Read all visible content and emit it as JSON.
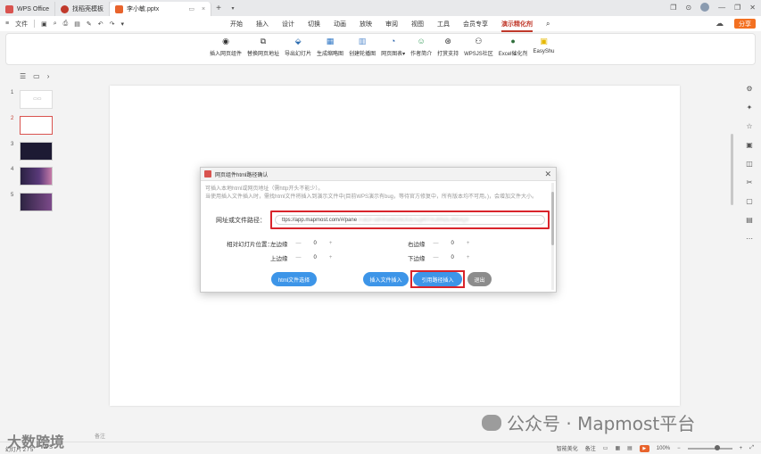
{
  "tabs": [
    {
      "label": "WPS Office",
      "color": "#d9534f"
    },
    {
      "label": "找稻壳模板",
      "color": "#c0392b"
    },
    {
      "label": "李小敏.pptx",
      "color": "#e8632c",
      "active": true
    }
  ],
  "menu": {
    "file": "文件",
    "tabs": [
      "开始",
      "插入",
      "设计",
      "切换",
      "动画",
      "放映",
      "审阅",
      "视图",
      "工具",
      "会员专享",
      "演示精化剂"
    ],
    "active_tab": "演示精化剂",
    "share": "分享"
  },
  "ribbon": [
    {
      "label": "插入网页组件",
      "icon": "chrome-icon",
      "glyph": "◉"
    },
    {
      "label": "替换网页地址",
      "icon": "swap-icon",
      "glyph": "⧉"
    },
    {
      "label": "导出幻灯片",
      "icon": "export-icon",
      "glyph": "⬙"
    },
    {
      "label": "生成缩略图",
      "icon": "grid-icon",
      "glyph": "▦"
    },
    {
      "label": "创建轮播图",
      "icon": "carousel-icon",
      "glyph": "▥"
    },
    {
      "label": "网页图表▾",
      "icon": "chart-icon",
      "glyph": "◔"
    },
    {
      "label": "作者简介",
      "icon": "author-icon",
      "glyph": "☺"
    },
    {
      "label": "打赏支持",
      "icon": "reward-icon",
      "glyph": "⊛"
    },
    {
      "label": "WPSJS社区",
      "icon": "community-icon",
      "glyph": "⚇"
    },
    {
      "label": "Excel催化剂",
      "icon": "excel-icon",
      "glyph": "●"
    },
    {
      "label": "EasyShu",
      "icon": "easyshu-icon",
      "glyph": "▣"
    }
  ],
  "slides": [
    "1",
    "2",
    "3",
    "4",
    "5"
  ],
  "dialog": {
    "title": "网页组件html路径确认",
    "desc1": "可插入本地html或网页地址（需http开头不能少）。",
    "desc2": "当使用插入文件插入时，需找html文件将插入到演示文件中(目前WPS演示有bug，等待官方修复中，所有版本均不可用。)，会增加文件大小。",
    "url_label": "网址或文件路径：",
    "url_value": "ttps://app.mapmost.com/#/pane",
    "url_hidden": "l=aGFodHRwMzhiOGE5ZjRlYmJhNzE4NGQ3",
    "pos_label": "相对幻灯片位置：",
    "left_label": "左边缘",
    "right_label": "右边缘",
    "top_label": "上边缘",
    "bottom_label": "下边缘",
    "minus": "—",
    "plus": "+",
    "left_val": "0",
    "right_val": "0",
    "top_val": "0",
    "bottom_val": "0",
    "btn_html": "html文件选择",
    "btn_insert_file": "插入文件插入",
    "btn_ref": "引用路径插入",
    "btn_exit": "退出"
  },
  "status": {
    "slide": "幻灯片 2 / 5",
    "theme": "WPS",
    "smart": "智能美化",
    "notes": "备注",
    "zoom": "100%"
  },
  "watermark": {
    "main": "公众号 · Mapmost平台",
    "left": "大数跨境",
    "left_note": "备注"
  }
}
